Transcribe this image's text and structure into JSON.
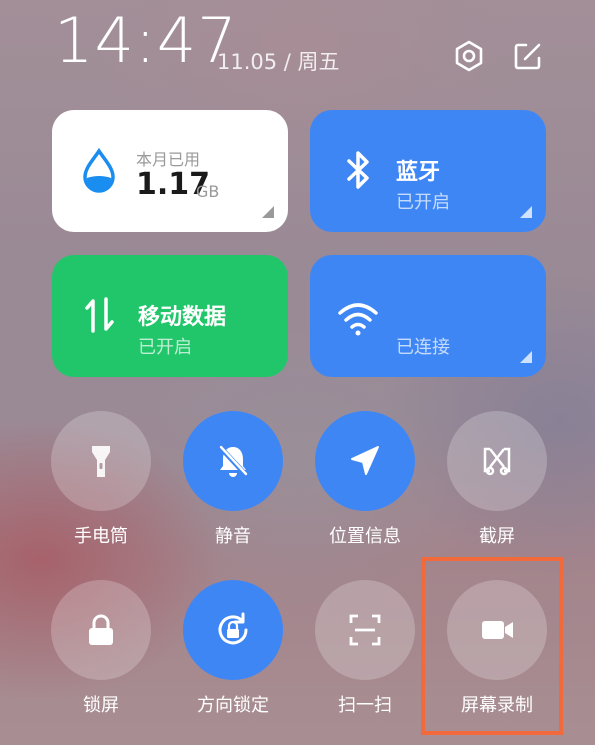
{
  "header": {
    "time": "14:47",
    "date": "11.05 / 周五",
    "settings_icon": "gear-hexagon-icon",
    "edit_icon": "edit-icon"
  },
  "tiles": {
    "data_usage": {
      "caption": "本月已用",
      "value": "1.17",
      "unit": "GB",
      "icon": "water-drop-icon"
    },
    "bluetooth": {
      "title": "蓝牙",
      "status": "已开启",
      "icon": "bluetooth-icon"
    },
    "mobile_data": {
      "title": "移动数据",
      "status": "已开启",
      "icon": "data-arrows-icon"
    },
    "wifi": {
      "title": "",
      "status": "已连接",
      "icon": "wifi-icon"
    }
  },
  "toggles": [
    {
      "label": "手电筒",
      "icon": "flashlight-icon",
      "active": false
    },
    {
      "label": "静音",
      "icon": "bell-mute-icon",
      "active": true
    },
    {
      "label": "位置信息",
      "icon": "location-icon",
      "active": true
    },
    {
      "label": "截屏",
      "icon": "screenshot-icon",
      "active": false
    },
    {
      "label": "锁屏",
      "icon": "lock-icon",
      "active": false
    },
    {
      "label": "方向锁定",
      "icon": "rotation-lock-icon",
      "active": true
    },
    {
      "label": "扫一扫",
      "icon": "scan-icon",
      "active": false
    },
    {
      "label": "屏幕录制",
      "icon": "video-camera-icon",
      "active": false
    }
  ],
  "colors": {
    "active_blue": "#3f86f5",
    "mobile_green": "#22c66a",
    "highlight_orange": "#f26a3c"
  }
}
